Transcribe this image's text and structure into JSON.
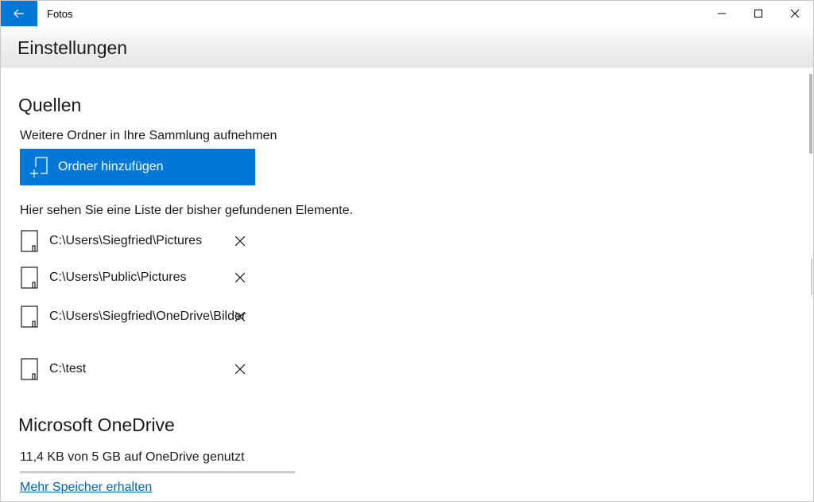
{
  "window": {
    "title": "Fotos"
  },
  "header": {
    "title": "Einstellungen"
  },
  "sources": {
    "title": "Quellen",
    "add_description": "Weitere Ordner in Ihre Sammlung aufnehmen",
    "add_button_label": "Ordner hinzufügen",
    "list_description": "Hier sehen Sie eine Liste der bisher gefundenen Elemente.",
    "folders": [
      {
        "path": "C:\\Users\\Siegfried\\Pictures"
      },
      {
        "path": "C:\\Users\\Public\\Pictures"
      },
      {
        "path": "C:\\Users\\Siegfried\\OneDrive\\Bilder"
      },
      {
        "path": "C:\\test"
      }
    ]
  },
  "onedrive": {
    "title": "Microsoft OneDrive",
    "usage_text": "11,4 KB von 5 GB auf OneDrive genutzt",
    "usage_fraction": 0.0,
    "link_label": "Mehr Speicher erhalten"
  },
  "colors": {
    "accent": "#0078d7",
    "link": "#0063b1"
  },
  "icons": {
    "back": "arrow-left-icon",
    "minimize": "minimize-icon",
    "maximize": "maximize-icon",
    "close": "close-icon",
    "add_folder": "add-folder-icon",
    "folder": "folder-icon",
    "remove": "remove-icon"
  }
}
